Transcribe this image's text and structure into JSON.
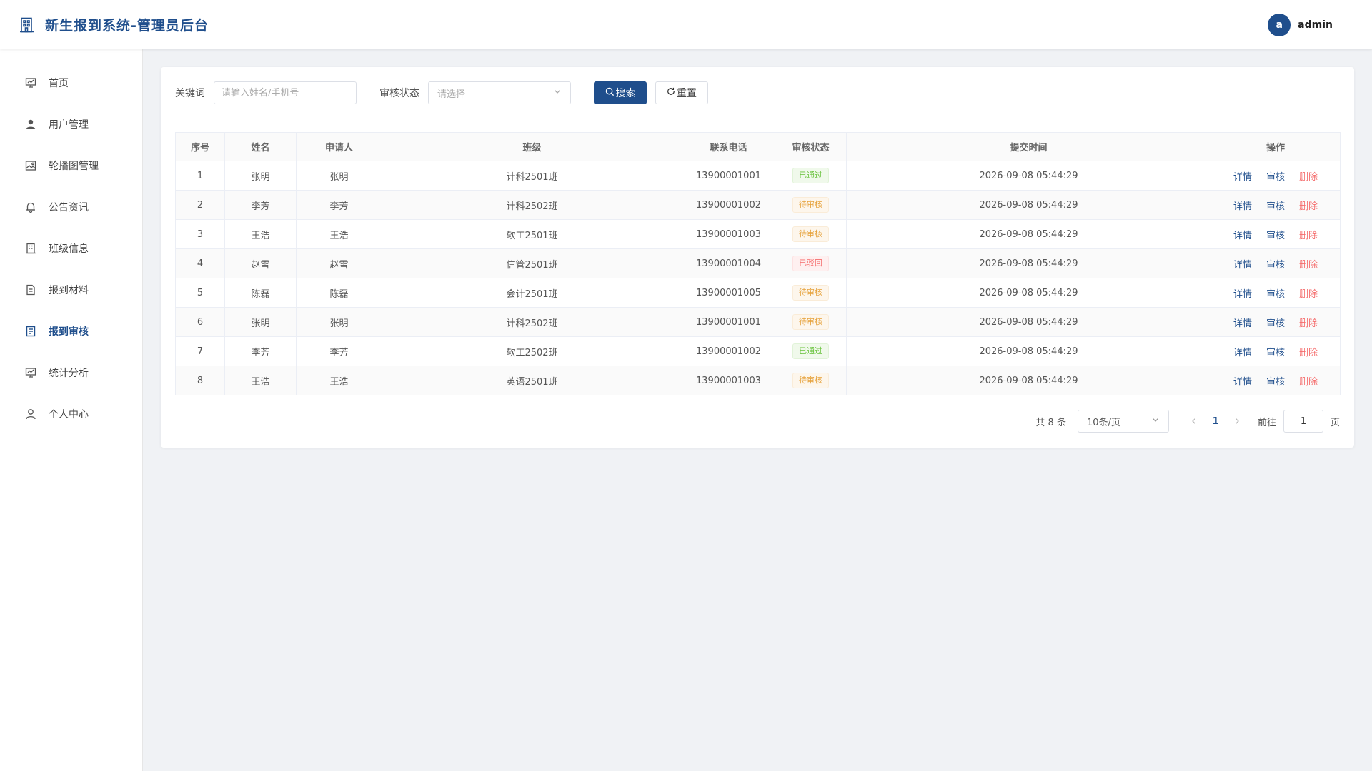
{
  "header": {
    "title": "新生报到系统-管理员后台",
    "avatar_letter": "a",
    "username": "admin"
  },
  "sidebar": {
    "items": [
      {
        "label": "首页",
        "icon": "dashboard-icon"
      },
      {
        "label": "用户管理",
        "icon": "user-icon"
      },
      {
        "label": "轮播图管理",
        "icon": "picture-icon"
      },
      {
        "label": "公告资讯",
        "icon": "bell-icon"
      },
      {
        "label": "班级信息",
        "icon": "building-icon"
      },
      {
        "label": "报到材料",
        "icon": "document-icon"
      },
      {
        "label": "报到审核",
        "icon": "document-check-icon",
        "active": true
      },
      {
        "label": "统计分析",
        "icon": "chart-icon"
      },
      {
        "label": "个人中心",
        "icon": "user-outline-icon"
      }
    ]
  },
  "filter": {
    "keyword_label": "关键词",
    "keyword_placeholder": "请输入姓名/手机号",
    "status_label": "审核状态",
    "status_placeholder": "请选择",
    "search_label": "搜索",
    "reset_label": "重置"
  },
  "table": {
    "headers": [
      "序号",
      "姓名",
      "申请人",
      "班级",
      "联系电话",
      "审核状态",
      "提交时间",
      "操作"
    ],
    "actions": {
      "detail": "详情",
      "review": "审核",
      "delete": "删除"
    },
    "rows": [
      {
        "no": "1",
        "name": "张明",
        "applicant": "张明",
        "class": "计科2501班",
        "phone": "13900001001",
        "status": "已通过",
        "status_type": "success",
        "time": "2026-09-08 05:44:29"
      },
      {
        "no": "2",
        "name": "李芳",
        "applicant": "李芳",
        "class": "计科2502班",
        "phone": "13900001002",
        "status": "待审核",
        "status_type": "warning",
        "time": "2026-09-08 05:44:29"
      },
      {
        "no": "3",
        "name": "王浩",
        "applicant": "王浩",
        "class": "软工2501班",
        "phone": "13900001003",
        "status": "待审核",
        "status_type": "warning",
        "time": "2026-09-08 05:44:29"
      },
      {
        "no": "4",
        "name": "赵雪",
        "applicant": "赵雪",
        "class": "信管2501班",
        "phone": "13900001004",
        "status": "已驳回",
        "status_type": "danger",
        "time": "2026-09-08 05:44:29"
      },
      {
        "no": "5",
        "name": "陈磊",
        "applicant": "陈磊",
        "class": "会计2501班",
        "phone": "13900001005",
        "status": "待审核",
        "status_type": "warning",
        "time": "2026-09-08 05:44:29"
      },
      {
        "no": "6",
        "name": "张明",
        "applicant": "张明",
        "class": "计科2502班",
        "phone": "13900001001",
        "status": "待审核",
        "status_type": "warning",
        "time": "2026-09-08 05:44:29"
      },
      {
        "no": "7",
        "name": "李芳",
        "applicant": "李芳",
        "class": "软工2502班",
        "phone": "13900001002",
        "status": "已通过",
        "status_type": "success",
        "time": "2026-09-08 05:44:29"
      },
      {
        "no": "8",
        "name": "王浩",
        "applicant": "王浩",
        "class": "英语2501班",
        "phone": "13900001003",
        "status": "待审核",
        "status_type": "warning",
        "time": "2026-09-08 05:44:29"
      }
    ]
  },
  "pager": {
    "total": "共 8 条",
    "page_size": "10条/页",
    "current": "1",
    "goto_label": "前往",
    "goto_value": "1",
    "page_suffix": "页"
  },
  "colors": {
    "primary": "#1f4e8c",
    "success": "#67c23a",
    "warning": "#e6a23c",
    "danger": "#f56c6c"
  }
}
